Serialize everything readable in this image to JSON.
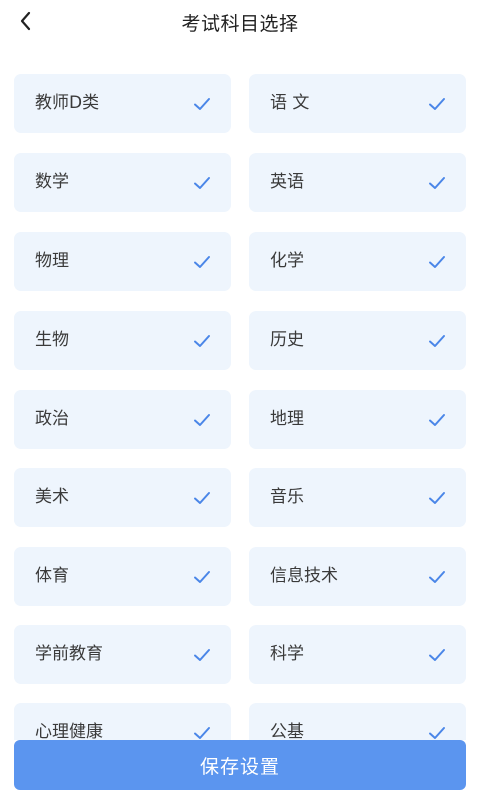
{
  "header": {
    "title": "考试科目选择"
  },
  "subjects": [
    {
      "label": "教师D类",
      "selected": true
    },
    {
      "label": "语 文",
      "selected": true
    },
    {
      "label": "数学",
      "selected": true
    },
    {
      "label": "英语",
      "selected": true
    },
    {
      "label": "物理",
      "selected": true
    },
    {
      "label": "化学",
      "selected": true
    },
    {
      "label": "生物",
      "selected": true
    },
    {
      "label": "历史",
      "selected": true
    },
    {
      "label": "政治",
      "selected": true
    },
    {
      "label": "地理",
      "selected": true
    },
    {
      "label": "美术",
      "selected": true
    },
    {
      "label": "音乐",
      "selected": true
    },
    {
      "label": "体育",
      "selected": true
    },
    {
      "label": "信息技术",
      "selected": true
    },
    {
      "label": "学前教育",
      "selected": true
    },
    {
      "label": "科学",
      "selected": true
    },
    {
      "label": "心理健康",
      "selected": true
    },
    {
      "label": "公基",
      "selected": true
    }
  ],
  "footer": {
    "save_label": "保存设置"
  },
  "colors": {
    "accent": "#5b95ef",
    "card_bg": "#eef5fd",
    "check": "#4a86e8"
  },
  "icons": {
    "back": "chevron-left-icon",
    "check": "check-icon"
  }
}
